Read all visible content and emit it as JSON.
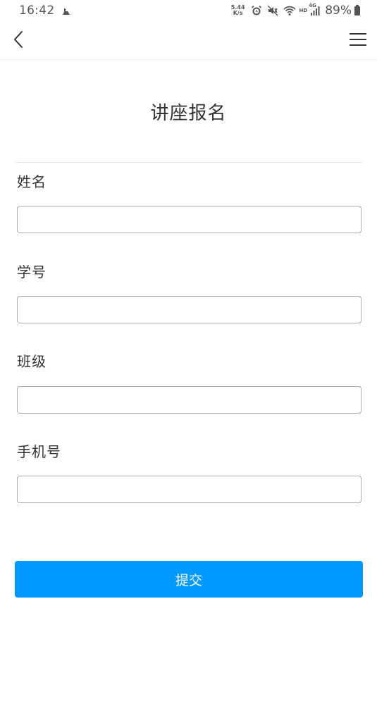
{
  "status_bar": {
    "time": "16:42",
    "notification_icon": "app-notification-icon",
    "net_speed_value": "5.44",
    "net_speed_unit": "K/s",
    "icons": [
      "alarm-icon",
      "mute-icon",
      "wifi-icon",
      "cellular-signal-icon"
    ],
    "hd_label": "HD",
    "network_type": "4G",
    "battery_percent": "89%",
    "battery_level": 0.89
  },
  "nav": {
    "back_icon": "chevron-left-icon",
    "menu_icon": "hamburger-menu-icon"
  },
  "page": {
    "title": "讲座报名"
  },
  "form": {
    "fields": [
      {
        "label": "姓名",
        "value": "",
        "placeholder": ""
      },
      {
        "label": "学号",
        "value": "",
        "placeholder": ""
      },
      {
        "label": "班级",
        "value": "",
        "placeholder": ""
      },
      {
        "label": "手机号",
        "value": "",
        "placeholder": ""
      }
    ],
    "submit_label": "提交"
  },
  "colors": {
    "accent": "#0099ff",
    "text": "#333333",
    "input_border": "#aaaaaa",
    "divider": "#e8e8e8"
  }
}
